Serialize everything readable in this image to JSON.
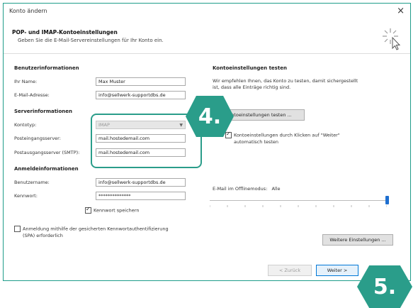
{
  "window": {
    "title": "Konto ändern",
    "close_glyph": "×"
  },
  "header": {
    "title": "POP- und IMAP-Kontoeinstellungen",
    "subtitle": "Geben Sie die E-Mail-Servereinstellungen für Ihr Konto ein.",
    "icon": "wizard-cursor-icon"
  },
  "user_info": {
    "heading": "Benutzerinformationen",
    "name_label": "Ihr Name:",
    "name_value": "Max Muster",
    "email_label": "E-Mail-Adresse:",
    "email_value": "info@sellwerk-supportdbs.de"
  },
  "server_info": {
    "heading": "Serverinformationen",
    "account_type_label": "Kontotyp:",
    "account_type_value": "IMAP",
    "incoming_label": "Posteingangsserver:",
    "incoming_value": "mail.hostedemail.com",
    "outgoing_label": "Postausgangsserver (SMTP):",
    "outgoing_value": "mail.hostedemail.com"
  },
  "login_info": {
    "heading": "Anmeldeinformationen",
    "username_label": "Benutzername:",
    "username_value": "info@sellwerk-supportdbs.de",
    "password_label": "Kennwort:",
    "password_value": "**************",
    "remember_label": "Kennwort speichern",
    "remember_checked": true,
    "spa_label_line1": "Anmeldung mithilfe der gesicherten Kennwortauthentifizierung",
    "spa_label_line2": "(SPA) erforderlich",
    "spa_checked": false
  },
  "test_settings": {
    "heading": "Kontoeinstellungen testen",
    "desc_line1": "Wir empfehlen Ihnen, das Konto zu testen, damit sichergestellt",
    "desc_line2": "ist, dass alle Einträge richtig sind.",
    "test_button": "Kontoeinstellungen testen ...",
    "auto_test_line1": "Kontoeinstellungen durch Klicken auf \"Weiter\"",
    "auto_test_line2": "automatisch testen",
    "auto_test_checked": true
  },
  "offline": {
    "label": "E-Mail im Offlinemodus:",
    "value": "Alle",
    "slider_fraction": 1.0
  },
  "more_settings_button": "Weitere Einstellungen ...",
  "footer": {
    "back_button": "< Zurück",
    "next_button": "Weiter >"
  },
  "callouts": {
    "step4": "4.",
    "step5": "5."
  },
  "colors": {
    "accent": "#2a9d8a",
    "slider": "#1e6fd0"
  }
}
